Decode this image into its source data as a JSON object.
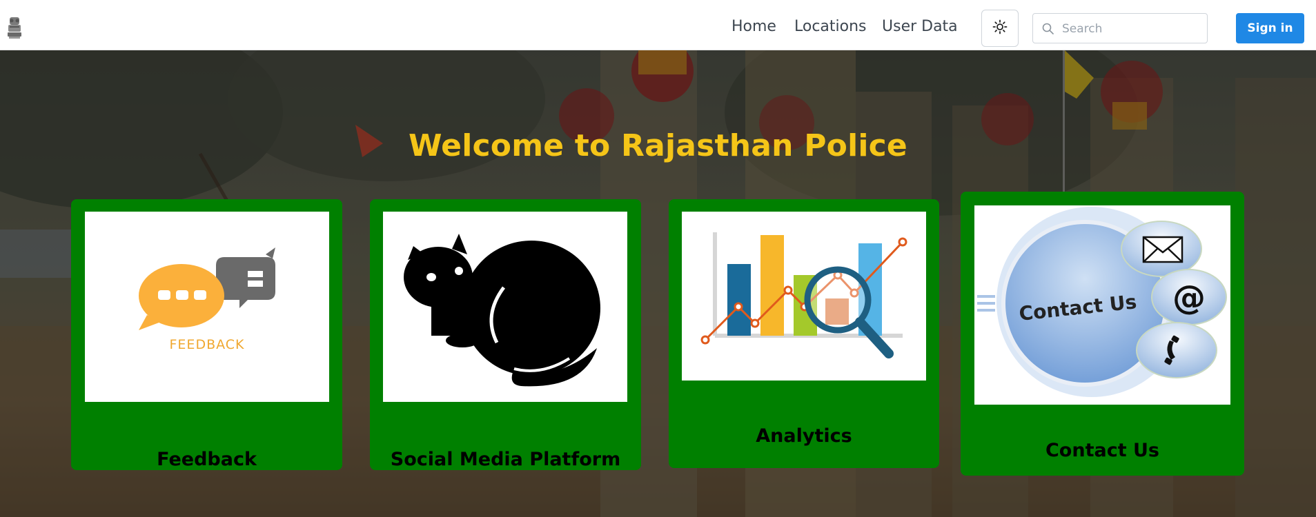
{
  "navbar": {
    "links": [
      "Home",
      "Locations",
      "User Data"
    ],
    "theme_toggle_icon": "sun-icon",
    "search": {
      "placeholder": "Search",
      "value": ""
    },
    "signin_label": "Sign in",
    "accent_color": "#1f88e5"
  },
  "hero": {
    "title": "Welcome to Rajasthan Police",
    "title_color": "#f5c518",
    "card_color": "#008000",
    "cards": [
      {
        "label": "Feedback",
        "image": "feedback-illustration",
        "image_text": "FEEDBACK"
      },
      {
        "label": "Social Media Platform",
        "image": "black-cat-illustration"
      },
      {
        "label": "Analytics",
        "image": "analytics-chart-illustration"
      },
      {
        "label": "Contact Us",
        "image": "contact-us-illustration",
        "image_text": "Contact Us"
      }
    ]
  }
}
